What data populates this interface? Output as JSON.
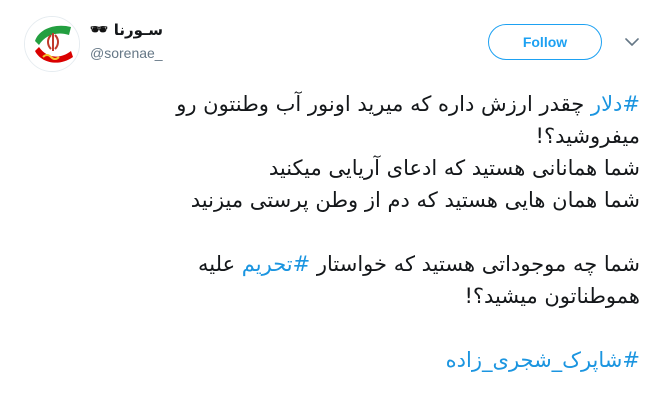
{
  "author": {
    "display_name": "سـورنا",
    "handle": "@sorenae_",
    "name_emoji": "🕶",
    "avatar_icon": "iran-flag-logo-icon"
  },
  "follow_button": {
    "label": "Follow"
  },
  "menu": {
    "icon": "chevron-down-icon"
  },
  "colors": {
    "accent": "#1da1f2",
    "hashtag": "#1b95e0",
    "text": "#14171a",
    "muted": "#657786"
  },
  "tweet": {
    "line1": {
      "hashtag": "#دلار",
      "text": " چقدر ارزش داره که میرید اونور آب وطنتون رو"
    },
    "line2": "میفروشید؟!",
    "line3": "شما همانانی هستید که ادعای آریایی میکنید",
    "line4": "شما همان هایی هستید که دم از وطن پرستی میزنید",
    "line5": {
      "before": "شما چه موجوداتی هستید که خواستار ",
      "hashtag": "#تحریم",
      "after": " علیه"
    },
    "line6": "هموطناتون میشید؟!",
    "line7": {
      "hashtag": "#شاپرک_شجری_زاده"
    }
  }
}
